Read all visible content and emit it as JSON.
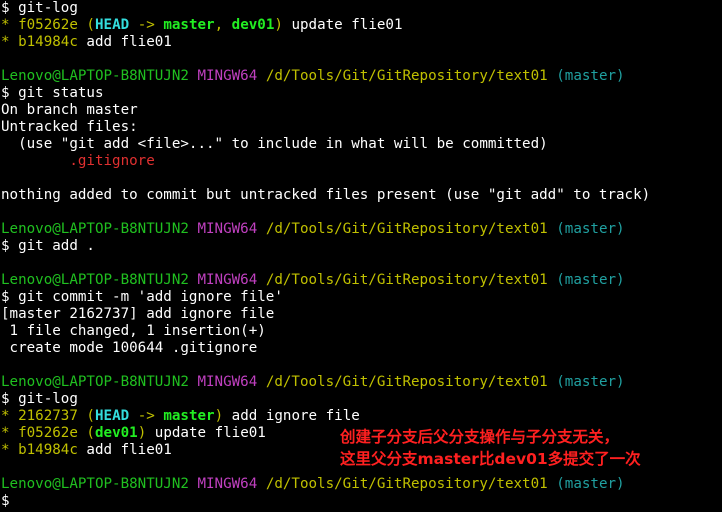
{
  "terminal": {
    "block1": {
      "cmd": "$ git-log",
      "log1": {
        "bullet": "* ",
        "hash": "f05262e",
        "open": " (",
        "head": "HEAD",
        "arrow": " -> ",
        "branch1": "master",
        "comma": ", ",
        "branch2": "dev01",
        "close": ")",
        "msg": " update flie01"
      },
      "log2": {
        "bullet": "* ",
        "hash": "b14984c",
        "msg": " add flie01"
      }
    },
    "prompt": {
      "user": "Lenovo@LAPTOP-B8NTUJN2",
      "shell": "MINGW64",
      "path": "/d/Tools/Git/GitRepository/text01",
      "branch": "(master)"
    },
    "block2": {
      "cmd": "$ git status",
      "l1": "On branch master",
      "l2": "Untracked files:",
      "l3": "  (use \"git add <file>...\" to include in what will be committed)",
      "file": "        .gitignore",
      "l5": "nothing added to commit but untracked files present (use \"git add\" to track)"
    },
    "block3": {
      "cmd": "$ git add ."
    },
    "block4": {
      "cmd": "$ git commit -m 'add ignore file'",
      "l1": "[master 2162737] add ignore file",
      "l2": " 1 file changed, 1 insertion(+)",
      "l3": " create mode 100644 .gitignore"
    },
    "block5": {
      "cmd": "$ git-log",
      "log1": {
        "bullet": "* ",
        "hash": "2162737",
        "open": " (",
        "head": "HEAD",
        "arrow": " -> ",
        "branch1": "master",
        "close": ")",
        "msg": " add ignore file"
      },
      "log2": {
        "bullet": "* ",
        "hash": "f05262e",
        "open": " (",
        "branch1": "dev01",
        "close": ")",
        "msg": " update flie01"
      },
      "log3": {
        "bullet": "* ",
        "hash": "b14984c",
        "msg": " add flie01"
      }
    },
    "final_prompt": "$ "
  },
  "annotation": {
    "line1": "创建子分支后父分支操作与子分支无关，",
    "line2": "这里父分支master比dev01多提交了一次"
  },
  "colors": {
    "background": "#000000",
    "hash": "#c0c000",
    "head": "#33dddd",
    "branch": "#22ee22",
    "user": "#20c020",
    "shell": "#c040c0",
    "path": "#c0c000",
    "prompt_branch": "#20a0a0",
    "untracked": "#e03030",
    "annotation": "#ff2020"
  }
}
